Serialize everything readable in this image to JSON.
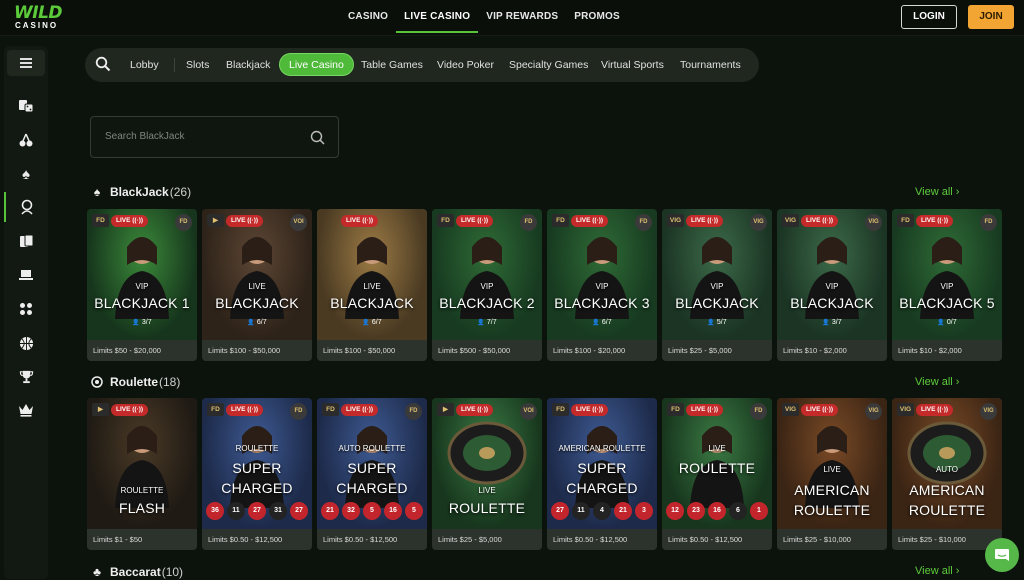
{
  "logo": {
    "word": "WILD",
    "sub": "CASINO"
  },
  "nav": {
    "items": [
      {
        "label": "CASINO",
        "active": false
      },
      {
        "label": "LIVE CASINO",
        "active": true
      },
      {
        "label": "VIP REWARDS",
        "active": false
      },
      {
        "label": "PROMOS",
        "active": false
      }
    ],
    "login": "LOGIN",
    "join": "JOIN"
  },
  "sidebar": {
    "icons": [
      "menu-icon",
      "cards-dice-icon",
      "cherry-icon",
      "spade-icon",
      "live-dealer-icon",
      "poker-cards-icon",
      "laptop-icon",
      "dice-icon",
      "basketball-icon",
      "trophy-icon",
      "crown-icon"
    ]
  },
  "filters": {
    "items": [
      "Lobby",
      "Slots",
      "Blackjack",
      "Live Casino",
      "Table Games",
      "Video Poker",
      "Specialty Games",
      "Virtual Sports",
      "Tournaments"
    ],
    "active": "Live Casino"
  },
  "search": {
    "placeholder": "Search BlackJack"
  },
  "sections": {
    "blackjack": {
      "title": "BlackJack",
      "count": "(26)",
      "view_all": "View all",
      "cards": [
        {
          "prov": "FD",
          "provR": "FD",
          "small": "VIP",
          "big": "BLACKJACK 1",
          "seats": "3/7",
          "limits": "Limits $50 - $20,000",
          "bg": "#16351c",
          "accent": "#3b8a3a"
        },
        {
          "prov": "▶",
          "provR": "VOI",
          "small": "LIVE",
          "big": "BLACKJACK",
          "seats": "6/7",
          "limits": "Limits $100 - $50,000",
          "bg": "#2e2319",
          "accent": "#5d4634"
        },
        {
          "prov": "",
          "provR": "",
          "small": "LIVE",
          "big": "BLACKJACK",
          "seats": "6/7",
          "limits": "Limits $100 - $50,000",
          "bg": "#4a3a22",
          "accent": "#9c7b45"
        },
        {
          "prov": "FD",
          "provR": "FD",
          "small": "VIP",
          "big": "BLACKJACK 2",
          "seats": "7/7",
          "limits": "Limits $500 - $50,000",
          "bg": "#173a20",
          "accent": "#2f6b36"
        },
        {
          "prov": "FD",
          "provR": "FD",
          "small": "VIP",
          "big": "BLACKJACK 3",
          "seats": "6/7",
          "limits": "Limits $100 - $20,000",
          "bg": "#173a20",
          "accent": "#2f6b36"
        },
        {
          "prov": "VIG",
          "provR": "VIG",
          "small": "VIP",
          "big": "BLACKJACK",
          "seats": "5/7",
          "limits": "Limits $25 - $5,000",
          "bg": "#1b3424",
          "accent": "#3c6a48"
        },
        {
          "prov": "VIG",
          "provR": "VIG",
          "small": "VIP",
          "big": "BLACKJACK",
          "seats": "3/7",
          "limits": "Limits $10 - $2,000",
          "bg": "#1b3424",
          "accent": "#3c6a48"
        },
        {
          "prov": "FD",
          "provR": "FD",
          "small": "VIP",
          "big": "BLACKJACK 5",
          "seats": "0/7",
          "limits": "Limits $10 - $2,000",
          "bg": "#173a20",
          "accent": "#2f6b36"
        }
      ]
    },
    "roulette": {
      "title": "Roulette",
      "count": "(18)",
      "view_all": "View all",
      "cards": [
        {
          "prov": "▶",
          "provR": "",
          "small": "ROULETTE",
          "big": "FLASH",
          "limits": "Limits $1 - $50",
          "bg": "#1f1a14",
          "accent": "#4a3a26",
          "nums": []
        },
        {
          "prov": "FD",
          "provR": "FD",
          "small": "ROULETTE",
          "big": "SUPER CHARGED",
          "limits": "Limits $0.50 - $12,500",
          "bg": "#1d2a4a",
          "accent": "#3e5a92",
          "nums": [
            [
              "36",
              "r"
            ],
            [
              "11",
              "b"
            ],
            [
              "27",
              "r"
            ],
            [
              "31",
              "b"
            ],
            [
              "27",
              "r"
            ]
          ]
        },
        {
          "prov": "FD",
          "provR": "FD",
          "small": "AUTO ROULETTE",
          "big": "SUPER CHARGED",
          "limits": "Limits $0.50 - $12,500",
          "bg": "#1d2a4a",
          "accent": "#3e5a92",
          "nums": [
            [
              "21",
              "r"
            ],
            [
              "32",
              "r"
            ],
            [
              "5",
              "r"
            ],
            [
              "16",
              "r"
            ],
            [
              "5",
              "r"
            ]
          ]
        },
        {
          "prov": "▶",
          "provR": "VOI",
          "small": "LIVE",
          "big": "ROULETTE",
          "limits": "Limits $25 - $5,000",
          "bg": "#17361d",
          "accent": "#3b7a44",
          "nums": []
        },
        {
          "prov": "FD",
          "provR": "",
          "small": "AMERICAN ROULETTE",
          "big": "SUPER CHARGED",
          "limits": "Limits $0.50 - $12,500",
          "bg": "#1d2a4a",
          "accent": "#3e5a92",
          "nums": [
            [
              "27",
              "r"
            ],
            [
              "11",
              "b"
            ],
            [
              "4",
              "b"
            ],
            [
              "21",
              "r"
            ],
            [
              "3",
              "r"
            ]
          ]
        },
        {
          "prov": "FD",
          "provR": "FD",
          "small": "LIVE",
          "big": "ROULETTE",
          "limits": "Limits $0.50 - $12,500",
          "bg": "#17361d",
          "accent": "#3b7a44",
          "nums": [
            [
              "12",
              "r"
            ],
            [
              "23",
              "r"
            ],
            [
              "16",
              "r"
            ],
            [
              "6",
              "b"
            ],
            [
              "1",
              "r"
            ]
          ]
        },
        {
          "prov": "VIG",
          "provR": "VIG",
          "small": "LIVE",
          "big": "AMERICAN ROULETTE",
          "limits": "Limits $25 - $10,000",
          "bg": "#3a2414",
          "accent": "#7a4a26",
          "nums": []
        },
        {
          "prov": "VIG",
          "provR": "VIG",
          "small": "AUTO",
          "big": "AMERICAN ROULETTE",
          "limits": "Limits $25 - $10,000",
          "bg": "#3a2414",
          "accent": "#7a4a26",
          "nums": []
        }
      ]
    },
    "baccarat": {
      "title": "Baccarat",
      "count": "(10)",
      "view_all": "View all"
    }
  },
  "live_label": "LIVE",
  "colors": {
    "accent": "#57c23a",
    "join": "#f2a533",
    "live": "#c42a2a"
  }
}
